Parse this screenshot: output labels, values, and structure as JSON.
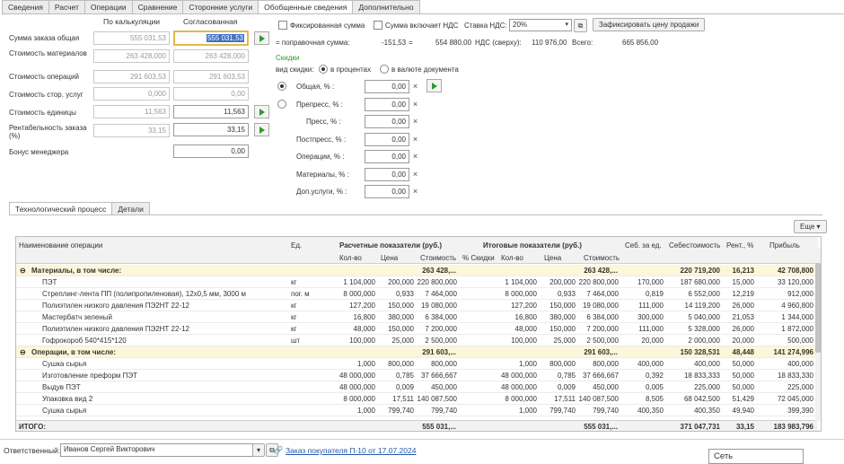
{
  "tabs": [
    "Сведения",
    "Расчет",
    "Операции",
    "Сравнение",
    "Сторонние услуги",
    "Обобщенные сведения",
    "Дополнительно"
  ],
  "active_tab": 5,
  "columns": {
    "calc": "По калькуляции",
    "agreed": "Согласованная"
  },
  "rows": [
    {
      "label": "Сумма заказа общая",
      "calc": "555 031,53",
      "agreed": "555 031,53"
    },
    {
      "label": "Стоимость материалов",
      "calc": "263 428,000",
      "agreed": "263 428,000"
    },
    {
      "label": "Стоимость операций",
      "calc": "291 603,53",
      "agreed": "291 603,53"
    },
    {
      "label": "Стоимость стор. услуг",
      "calc": "0,000",
      "agreed": "0,00"
    },
    {
      "label": "Стоимость единицы",
      "calc": "11,563",
      "agreed": "11,563"
    },
    {
      "label": "Рентабельность заказа (%)",
      "calc": "33,15",
      "agreed": "33,15"
    },
    {
      "label": "Бонус менеджера",
      "calc": "",
      "agreed": "0,00"
    }
  ],
  "right": {
    "fixed_sum": "Фиксированная сумма",
    "incl_vat": "Сумма включает НДС",
    "vat_rate_label": "Ставка НДС:",
    "vat_rate": "20%",
    "fix_price_btn": "Зафиксировать цену продажи",
    "corr_label": "= поправочная сумма:",
    "corr_value": "-151,53",
    "corr_eq": "=",
    "corr_total": "554 880,00",
    "vat_over_label": "НДС (сверху):",
    "vat_over": "110 976,00",
    "total_label": "Всего:",
    "total": "665 856,00",
    "discounts_title": "Скидки",
    "discount_type_label": "вид скидки:",
    "opt_percent": "в процентах",
    "opt_currency": "в валюте документа",
    "disc_rows": [
      {
        "label": "Общая, % :",
        "value": "0,00"
      },
      {
        "label": "Препресс, % :",
        "value": "0,00"
      },
      {
        "label": "Пресс, % :",
        "value": "0,00"
      },
      {
        "label": "Постпресс, % :",
        "value": "0,00"
      },
      {
        "label": "Операции, % :",
        "value": "0,00"
      },
      {
        "label": "Материалы, % :",
        "value": "0,00"
      },
      {
        "label": "Доп.услуги, % :",
        "value": "0,00"
      }
    ]
  },
  "inner_tabs": [
    "Технологический процесс",
    "Детали"
  ],
  "more_btn": "Еще",
  "grid": {
    "h_name": "Наименование операции",
    "h_unit": "Ед.",
    "h_calc": "Расчетные показатели (руб.)",
    "h_final": "Итоговые показатели (руб.)",
    "h_cost_unit": "Себ. за ед.",
    "h_cost": "Себестоимость",
    "h_rent": "Рент., %",
    "h_profit": "Прибыль",
    "sub": {
      "qty": "Кол-во",
      "price": "Цена",
      "amount": "Стоимость",
      "disc": "% Скидки"
    },
    "rows": [
      {
        "g": true,
        "name": "Материалы, в том числе:",
        "amount": "263 428,...",
        "famount": "263 428,...",
        "cost": "220 719,200",
        "rent": "16,213",
        "profit": "42 708,800"
      },
      {
        "name": "ПЭТ",
        "unit": "кг",
        "qty": "1 104,000",
        "price": "200,000",
        "amount": "220 800,000",
        "fqty": "1 104,000",
        "fprice": "200,000",
        "famount": "220 800,000",
        "cu": "170,000",
        "cost": "187 680,000",
        "rent": "15,000",
        "profit": "33 120,000"
      },
      {
        "name": "Стреплинг-лента ПП (полипропиленовая), 12х0,5 мм, 3000 м",
        "unit": "пог. м",
        "qty": "8 000,000",
        "price": "0,933",
        "amount": "7 464,000",
        "fqty": "8 000,000",
        "fprice": "0,933",
        "famount": "7 464,000",
        "cu": "0,819",
        "cost": "6 552,000",
        "rent": "12,219",
        "profit": "912,000"
      },
      {
        "name": "Полиэтилен низкого давления ПЭ2НТ 22-12",
        "unit": "кг",
        "qty": "127,200",
        "price": "150,000",
        "amount": "19 080,000",
        "fqty": "127,200",
        "fprice": "150,000",
        "famount": "19 080,000",
        "cu": "111,000",
        "cost": "14 119,200",
        "rent": "26,000",
        "profit": "4 960,800"
      },
      {
        "name": "Мастербатч зеленый",
        "unit": "кг",
        "qty": "16,800",
        "price": "380,000",
        "amount": "6 384,000",
        "fqty": "16,800",
        "fprice": "380,000",
        "famount": "6 384,000",
        "cu": "300,000",
        "cost": "5 040,000",
        "rent": "21,053",
        "profit": "1 344,000"
      },
      {
        "name": "Полиэтилен низкого давления ПЭ2НТ 22-12",
        "unit": "кг",
        "qty": "48,000",
        "price": "150,000",
        "amount": "7 200,000",
        "fqty": "48,000",
        "fprice": "150,000",
        "famount": "7 200,000",
        "cu": "111,000",
        "cost": "5 328,000",
        "rent": "26,000",
        "profit": "1 872,000"
      },
      {
        "name": "Гофрокороб 540*415*120",
        "unit": "шт",
        "qty": "100,000",
        "price": "25,000",
        "amount": "2 500,000",
        "fqty": "100,000",
        "fprice": "25,000",
        "famount": "2 500,000",
        "cu": "20,000",
        "cost": "2 000,000",
        "rent": "20,000",
        "profit": "500,000"
      },
      {
        "g": true,
        "name": "Операции, в том числе:",
        "amount": "291 603,...",
        "famount": "291 603,...",
        "cost": "150 328,531",
        "rent": "48,448",
        "profit": "141 274,996"
      },
      {
        "name": "Сушка сырья",
        "unit": "",
        "qty": "1,000",
        "price": "800,000",
        "amount": "800,000",
        "fqty": "1,000",
        "fprice": "800,000",
        "famount": "800,000",
        "cu": "400,000",
        "cost": "400,000",
        "rent": "50,000",
        "profit": "400,000"
      },
      {
        "name": "Изготовление преформ ПЭТ",
        "unit": "",
        "qty": "48 000,000",
        "price": "0,785",
        "amount": "37 666,667",
        "fqty": "48 000,000",
        "fprice": "0,785",
        "famount": "37 666,667",
        "cu": "0,392",
        "cost": "18 833,333",
        "rent": "50,000",
        "profit": "18 833,330"
      },
      {
        "name": "Выдув ПЭТ",
        "unit": "",
        "qty": "48 000,000",
        "price": "0,009",
        "amount": "450,000",
        "fqty": "48 000,000",
        "fprice": "0,009",
        "famount": "450,000",
        "cu": "0,005",
        "cost": "225,000",
        "rent": "50,000",
        "profit": "225,000"
      },
      {
        "name": "Упаковка вид 2",
        "unit": "",
        "qty": "8 000,000",
        "price": "17,511",
        "amount": "140 087,500",
        "fqty": "8 000,000",
        "fprice": "17,511",
        "famount": "140 087,500",
        "cu": "8,505",
        "cost": "68 042,500",
        "rent": "51,429",
        "profit": "72 045,000"
      },
      {
        "name": "Сушка сырья",
        "unit": "",
        "qty": "1,000",
        "price": "799,740",
        "amount": "799,740",
        "fqty": "1,000",
        "fprice": "799,740",
        "famount": "799,740",
        "cu": "400,350",
        "cost": "400,350",
        "rent": "49,940",
        "profit": "399,390"
      }
    ],
    "total": {
      "name": "ИТОГО:",
      "amount": "555 031,...",
      "famount": "555 031,...",
      "cost": "371 047,731",
      "rent": "33,15",
      "profit": "183 983,796"
    }
  },
  "footer": {
    "resp_label": "Ответственный:",
    "resp_value": "Иванов Сергей Викторович",
    "order_link": "Заказ покупателя П-10 от 17.07.2024",
    "popup": "Сеть"
  }
}
